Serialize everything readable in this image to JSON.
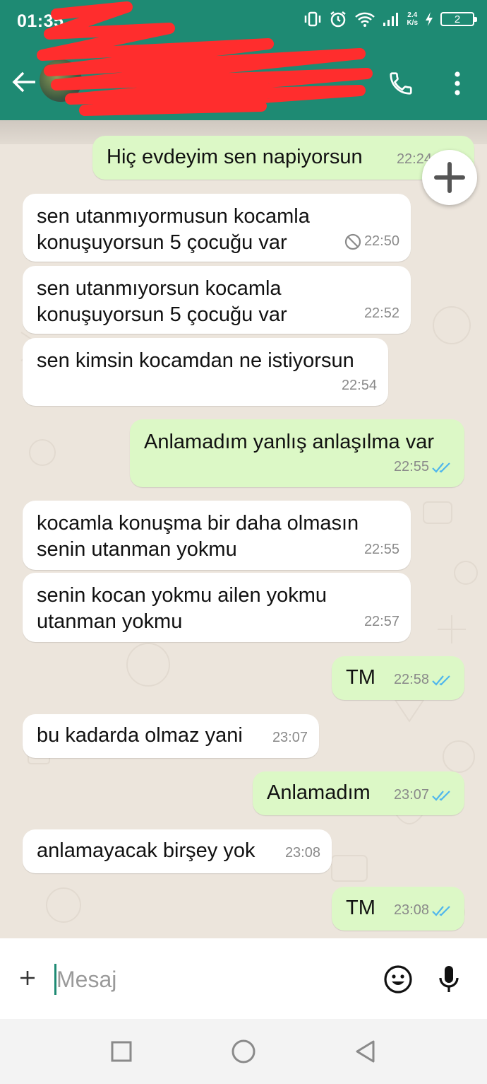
{
  "status_bar": {
    "time": "01:35",
    "net_speed_value": "2.4",
    "net_speed_unit": "K/s",
    "battery": "2"
  },
  "header": {
    "contact_name_redacted": true
  },
  "messages": [
    {
      "dir": "out",
      "text": "Hiç evdeyim sen napiyorsun",
      "time": "22:24",
      "status": "none"
    },
    {
      "dir": "in",
      "text": "sen utanmıyormusun kocamla\nkonuşuyorsun 5 çocuğu var",
      "time": "22:50",
      "status": "deleted"
    },
    {
      "dir": "in",
      "text": "sen utanmıyorsun kocamla\nkonuşuyorsun 5 çocuğu var",
      "time": "22:52",
      "status": "none"
    },
    {
      "dir": "in",
      "text": "sen kimsin kocamdan ne istiyorsun",
      "time": "22:54",
      "status": "none"
    },
    {
      "dir": "out",
      "text": "Anlamadım yanlış anlaşılma var",
      "time": "22:55",
      "status": "read"
    },
    {
      "dir": "in",
      "text": "kocamla konuşma bir daha olmasın\nsenin utanman yokmu",
      "time": "22:55",
      "status": "none"
    },
    {
      "dir": "in",
      "text": "senin kocan yokmu ailen yokmu\nutanman yokmu",
      "time": "22:57",
      "status": "none"
    },
    {
      "dir": "out",
      "text": "TM",
      "time": "22:58",
      "status": "read"
    },
    {
      "dir": "in",
      "text": "bu kadarda olmaz yani",
      "time": "23:07",
      "status": "none"
    },
    {
      "dir": "out",
      "text": "Anlamadım",
      "time": "23:07",
      "status": "read"
    },
    {
      "dir": "in",
      "text": "anlamayacak birşey yok",
      "time": "23:08",
      "status": "none"
    },
    {
      "dir": "out",
      "text": "TM",
      "time": "23:08",
      "status": "read"
    }
  ],
  "composer": {
    "placeholder": "Mesaj",
    "value": ""
  },
  "icons": {
    "back": "arrow-left-icon",
    "call": "phone-icon",
    "menu": "more-vert-icon",
    "attach": "plus-icon",
    "emoji": "smiley-icon",
    "mic": "microphone-icon",
    "fab": "plus-icon"
  },
  "colors": {
    "header": "#1e8a73",
    "outgoing_bubble": "#dcf8c6",
    "incoming_bubble": "#ffffff",
    "read_ticks": "#4fb6ec",
    "chat_bg": "#ece5dc",
    "redaction": "#ff2d2d"
  }
}
